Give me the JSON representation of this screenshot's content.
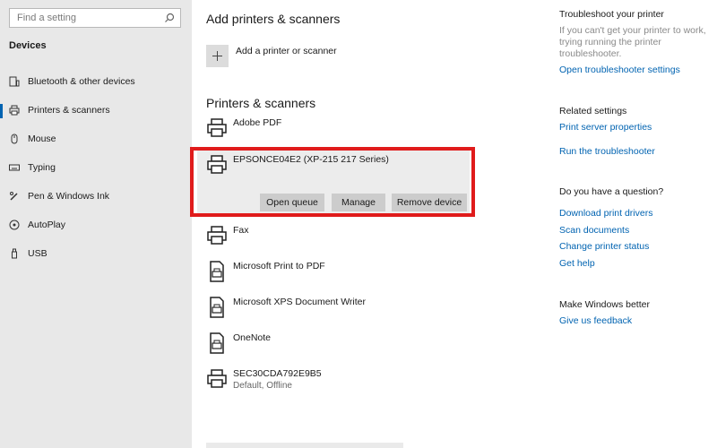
{
  "sidebar": {
    "search_placeholder": "Find a setting",
    "category": "Devices",
    "items": [
      {
        "label": "Bluetooth & other devices",
        "icon": "bluetooth-devices-icon"
      },
      {
        "label": "Printers & scanners",
        "icon": "printer-icon",
        "active": true
      },
      {
        "label": "Mouse",
        "icon": "mouse-icon"
      },
      {
        "label": "Typing",
        "icon": "keyboard-icon"
      },
      {
        "label": "Pen & Windows Ink",
        "icon": "pen-icon"
      },
      {
        "label": "AutoPlay",
        "icon": "autoplay-icon"
      },
      {
        "label": "USB",
        "icon": "usb-icon"
      }
    ]
  },
  "main": {
    "add_heading": "Add printers & scanners",
    "add_label": "Add a printer or scanner",
    "printers_heading": "Printers & scanners",
    "printers": [
      {
        "name": "Adobe PDF",
        "icon": "printer-icon"
      },
      {
        "name": "EPSONCE04E2 (XP-215 217 Series)",
        "icon": "printer-icon",
        "selected": true
      },
      {
        "name": "Fax",
        "icon": "printer-icon"
      },
      {
        "name": "Microsoft Print to PDF",
        "icon": "document-printer-icon"
      },
      {
        "name": "Microsoft XPS Document Writer",
        "icon": "document-printer-icon"
      },
      {
        "name": "OneNote",
        "icon": "document-printer-icon"
      },
      {
        "name": "SEC30CDA792E9B5",
        "status": "Default, Offline",
        "icon": "printer-icon"
      }
    ],
    "buttons": {
      "open_queue": "Open queue",
      "manage": "Manage",
      "remove_device": "Remove device"
    }
  },
  "right": {
    "troubleshoot_heading": "Troubleshoot your printer",
    "troubleshoot_text": "If you can't get your printer to work, trying running the printer troubleshooter.",
    "troubleshoot_link": "Open troubleshooter settings",
    "related_heading": "Related settings",
    "related_links": [
      "Print server properties",
      "Run the troubleshooter"
    ],
    "question_heading": "Do you have a question?",
    "question_links": [
      "Download print drivers",
      "Scan documents",
      "Change printer status",
      "Get help"
    ],
    "better_heading": "Make Windows better",
    "feedback_link": "Give us feedback"
  },
  "colors": {
    "accent": "#0063b1",
    "highlight": "#e01b1b",
    "sidebar_bg": "#e8e8e8"
  }
}
